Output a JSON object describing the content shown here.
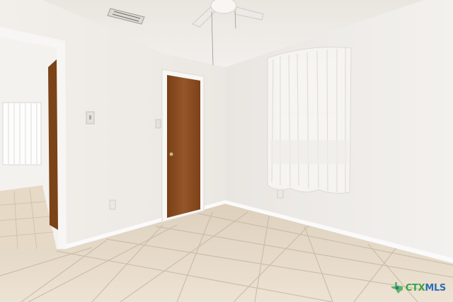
{
  "watermark": {
    "part1": "CTX",
    "part2": "MLS",
    "icon": "texas-map-icon",
    "colors": {
      "ctx": "#3fa34a",
      "mls": "#2f6fb3",
      "icon_green": "#5cb85c",
      "icon_blue": "#2f6fb3"
    }
  },
  "scene": {
    "colors": {
      "wall": "#f0ede9",
      "wall_shade": "#e7e3de",
      "ceiling": "#eeebe6",
      "floor_tile": "#e8dccb",
      "grout": "#c9bba6",
      "door": "#8a4b1e",
      "curtain": "#f6f5f2"
    }
  }
}
